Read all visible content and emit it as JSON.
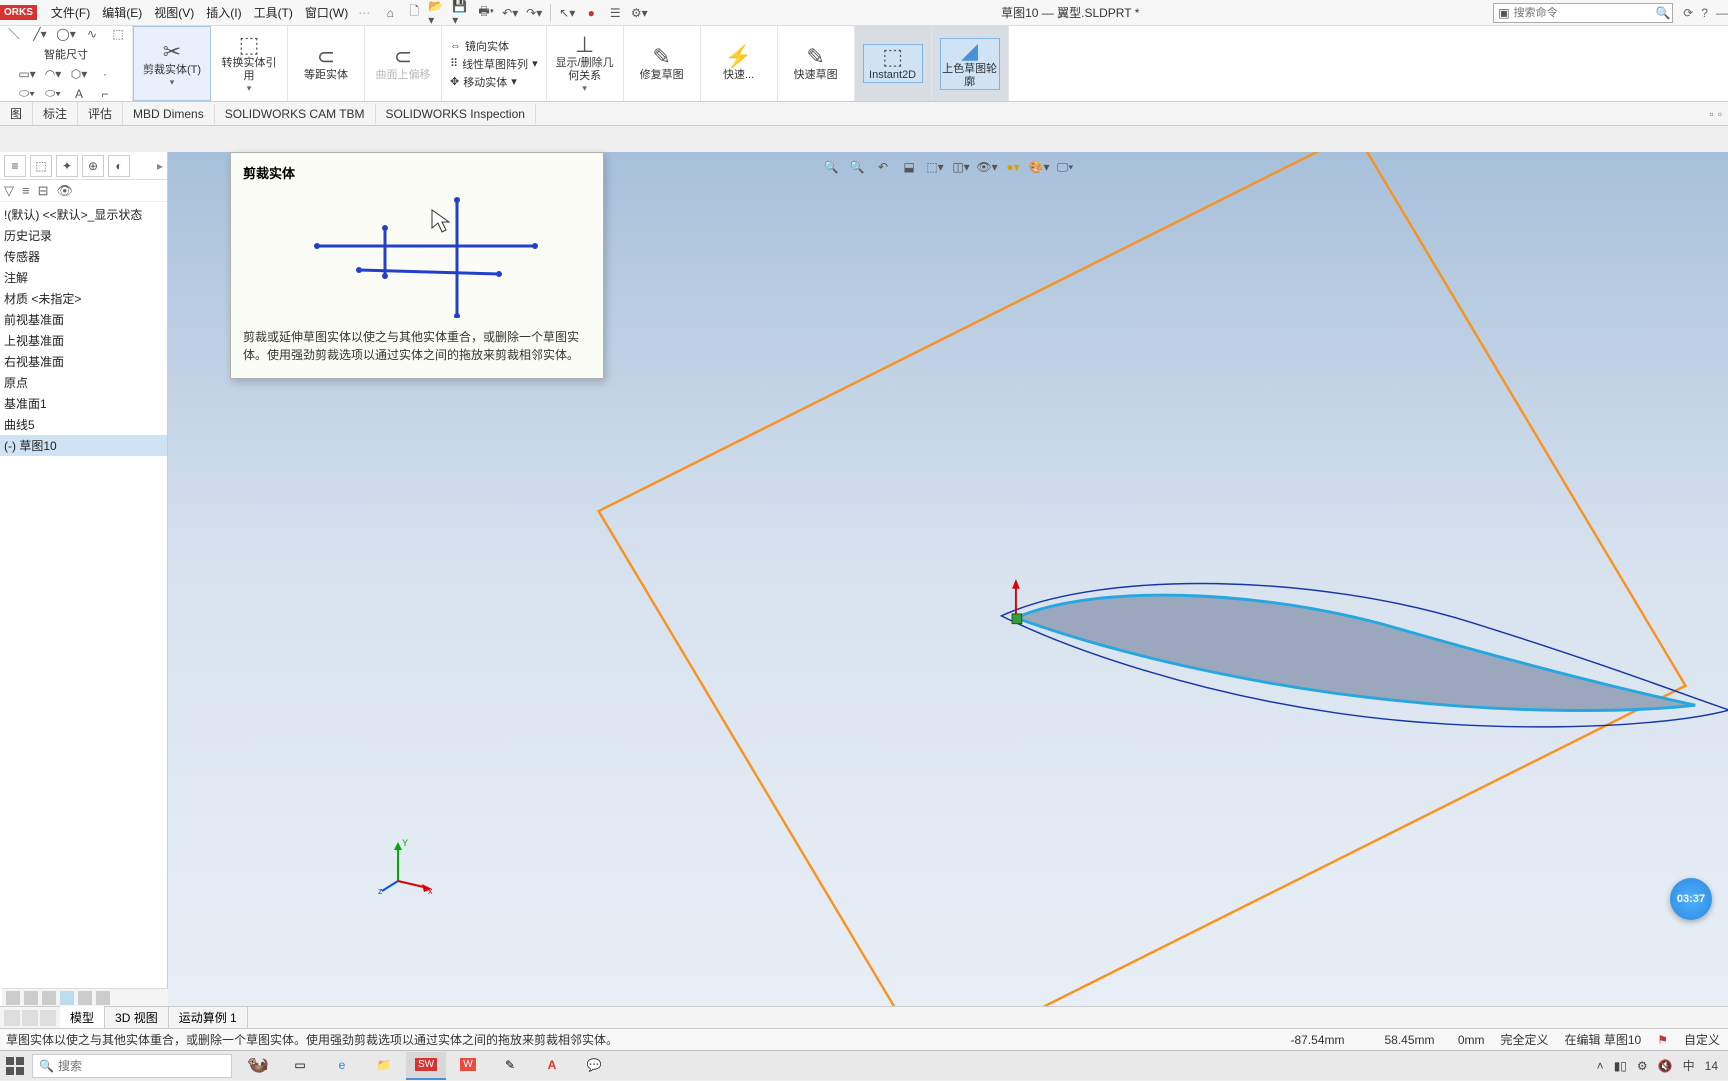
{
  "app_badge": "ORKS",
  "menu": {
    "file": "文件(F)",
    "edit": "编辑(E)",
    "view": "视图(V)",
    "insert": "插入(I)",
    "tools": "工具(T)",
    "window": "窗口(W)"
  },
  "doc_title": "草图10 — 翼型.SLDPRT *",
  "search_cmd_placeholder": "搜索命令",
  "ribbon": {
    "smart_dim": "智能尺寸",
    "trim": "剪裁实体(T)",
    "convert": "转换实体引用",
    "offset": "等距实体",
    "on_surface": "曲面上偏移",
    "mirror": "镜向实体",
    "linear_pattern": "线性草图阵列",
    "move": "移动实体",
    "show_hide": "显示/删除几何关系",
    "repair": "修复草图",
    "quick": "快速...",
    "quick_sketch": "快速草图",
    "instant2d": "Instant2D",
    "shaded": "上色草图轮廓"
  },
  "tabs": {
    "t1": "图",
    "t2": "标注",
    "t3": "评估",
    "t4": "MBD Dimens",
    "t5": "SOLIDWORKS CAM TBM",
    "t6": "SOLIDWORKS Inspection"
  },
  "tooltip": {
    "title": "剪裁实体",
    "desc": "剪裁或延伸草图实体以使之与其他实体重合，或删除一个草图实体。使用强劲剪裁选项以通过实体之间的拖放来剪裁相邻实体。"
  },
  "tree": {
    "root": "!(默认) <<默认>_显示状态",
    "history": "历史记录",
    "sensors": "传感器",
    "annotations": "注解",
    "material": "材质 <未指定>",
    "front": "前视基准面",
    "top": "上视基准面",
    "right": "右视基准面",
    "origin": "原点",
    "plane1": "基准面1",
    "curve5": "曲线5",
    "sketch10": "(-) 草图10"
  },
  "bottom_tabs": {
    "model": "模型",
    "view3d": "3D 视图",
    "motion1": "运动算例 1"
  },
  "status": {
    "hint": "草图实体以使之与其他实体重合，或删除一个草图实体。使用强劲剪裁选项以通过实体之间的拖放来剪裁相邻实体。",
    "x": "-87.54mm",
    "y": "58.45mm",
    "z": "0mm",
    "def": "完全定义",
    "editing": "在编辑 草图10",
    "custom": "自定义"
  },
  "taskbar": {
    "search_placeholder": "搜索",
    "ime": "中",
    "time": "14"
  },
  "timer": "03:37",
  "triad": {
    "x": "x",
    "y": "Y",
    "z": "z"
  },
  "chart_data": {
    "type": "table",
    "note": "No chart present; CAD UI screenshot."
  }
}
